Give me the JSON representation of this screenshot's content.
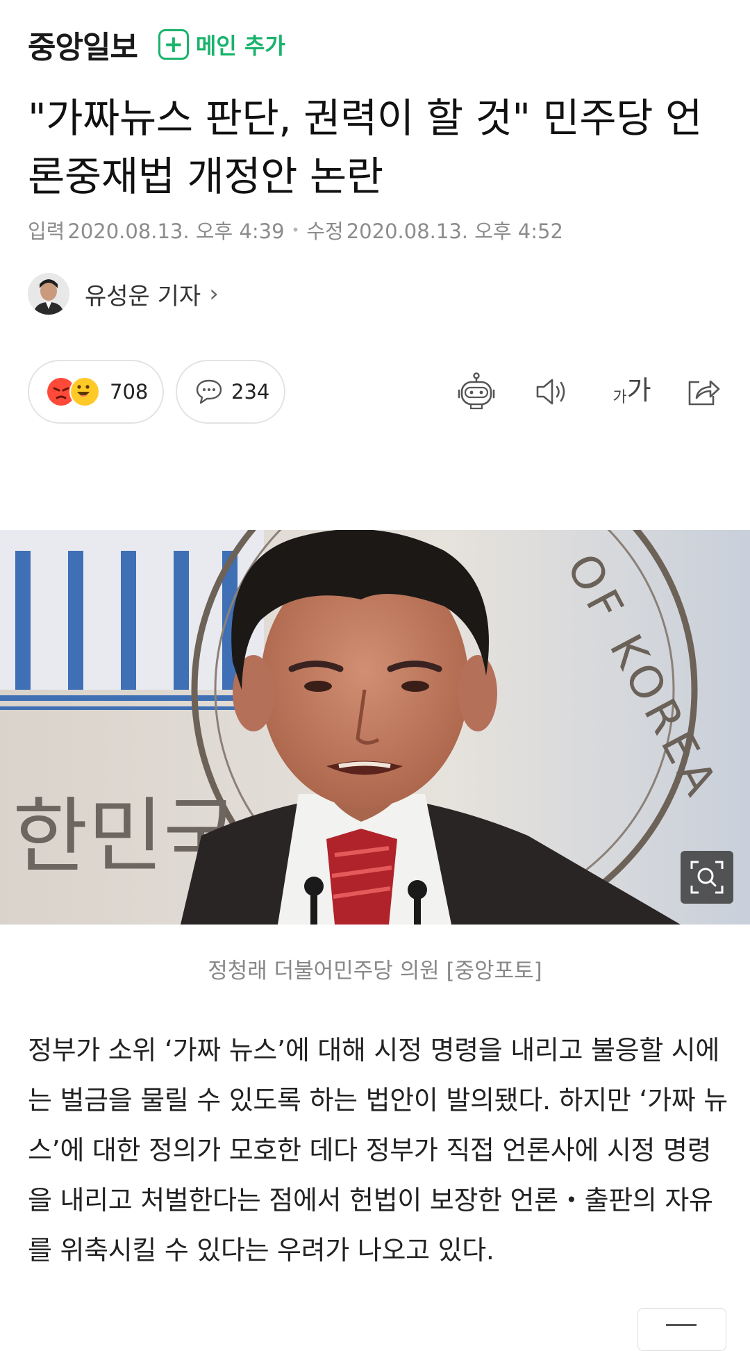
{
  "header": {
    "brand": "중앙일보",
    "main_add_label": "메인 추가"
  },
  "article": {
    "title": "\"가짜뉴스 판단, 권력이 할 것\" 민주당 언론중재법 개정안 논란",
    "published_label": "입력",
    "published": "2020.08.13. 오후 4:39",
    "modified_label": "수정",
    "modified": "2020.08.13. 오후 4:52",
    "reporter": "유성운 기자",
    "caption": "정청래 더불어민주당 의원 [중앙포토]",
    "body": "정부가 소위 ‘가짜 뉴스’에 대해 시정 명령을 내리고 불응할 시에는 벌금을 물릴 수 있도록 하는 법안이 발의됐다. 하지만 ‘가짜 뉴스’에 대한 정의가 모호한 데다 정부가 직접 언론사에 시정 명령을 내리고 처벌한다는 점에서 헌법이 보장한 언론・출판의 자유를 위축시킬 수 있다는 우려가 나오고 있다."
  },
  "actions": {
    "reactions_count": "708",
    "comments_count": "234",
    "font_size_small": "가",
    "font_size_large": "가"
  },
  "photo": {
    "backdrop_text": "한민국",
    "seal_text": "OF KOREA"
  },
  "icons": [
    "plus-icon",
    "chevron-right-icon",
    "angry-emoji-icon",
    "smile-emoji-icon",
    "comment-icon",
    "robot-summary-icon",
    "speaker-icon",
    "font-size-icon",
    "share-icon",
    "zoom-icon"
  ],
  "colors": {
    "brand_green": "#19b36b",
    "meta_gray": "#8c8c8c",
    "caption_gray": "#888888"
  }
}
